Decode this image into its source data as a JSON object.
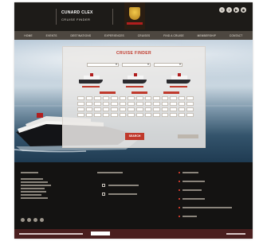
{
  "header": {
    "brand_line1": "CUNARD CLEX",
    "brand_line2": "CRUISE FINDER",
    "social_icons": [
      "twitter-icon",
      "facebook-icon",
      "youtube-icon",
      "rss-icon"
    ]
  },
  "nav": {
    "items": [
      "HOME",
      "EVENTS",
      "DESTINATIONS",
      "EXPERIENCES",
      "CRUISES",
      "FIND A CRUISE",
      "MEMBERSHIP",
      "CONTACT"
    ]
  },
  "finder": {
    "title": "CRUISE FINDER",
    "search_label": "SEARCH"
  },
  "colors": {
    "accent_red": "#c0392b",
    "header_dark": "#1d1b18",
    "bottom_bar": "#4a1f1f"
  }
}
